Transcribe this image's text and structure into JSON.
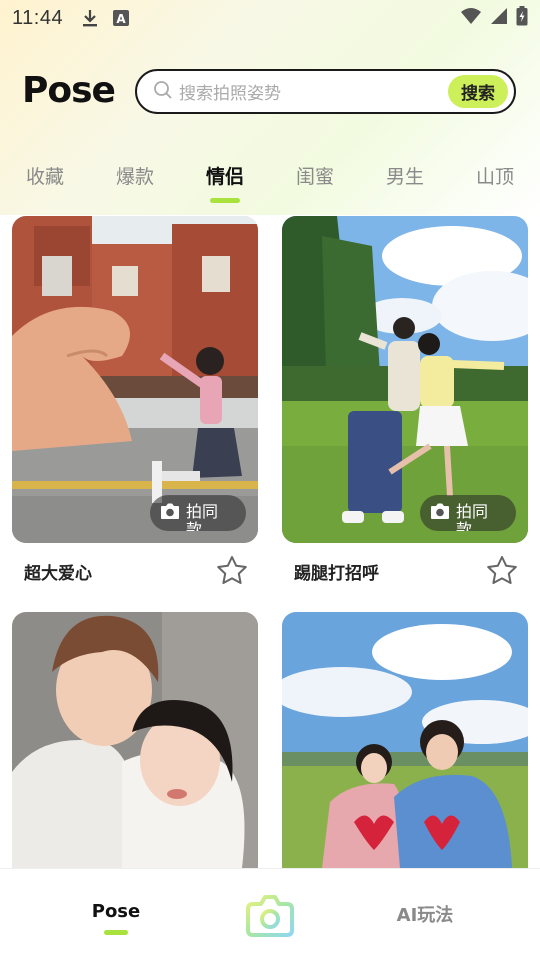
{
  "status_bar": {
    "time": "11:44",
    "icons": [
      "download-icon",
      "notification-a-icon",
      "wifi-icon",
      "signal-icon",
      "battery-icon"
    ]
  },
  "header": {
    "logo": "Pose",
    "search_placeholder": "搜索拍照姿势",
    "search_button": "搜索"
  },
  "tabs": {
    "items": [
      "收藏",
      "爆款",
      "情侣",
      "闺蜜",
      "男生",
      "山顶"
    ],
    "active": "情侣"
  },
  "cards": [
    {
      "title": "超大爱心",
      "button": "拍同款",
      "image": "couple-heart-hand-photo"
    },
    {
      "title": "踢腿打招呼",
      "button": "拍同款",
      "image": "couple-kicking-park-photo"
    },
    {
      "title": "",
      "button": "",
      "image": "couple-hug-closeup-photo"
    },
    {
      "title": "",
      "button": "",
      "image": "couple-matching-sweaters-photo"
    }
  ],
  "bottom_nav": {
    "pose": "Pose",
    "camera": "camera-icon",
    "ai": "AI玩法"
  },
  "colors": {
    "accent": "#a9e23c",
    "search_button": "#cdf05a",
    "text_primary": "#111111",
    "text_secondary": "#8a8a8a"
  }
}
